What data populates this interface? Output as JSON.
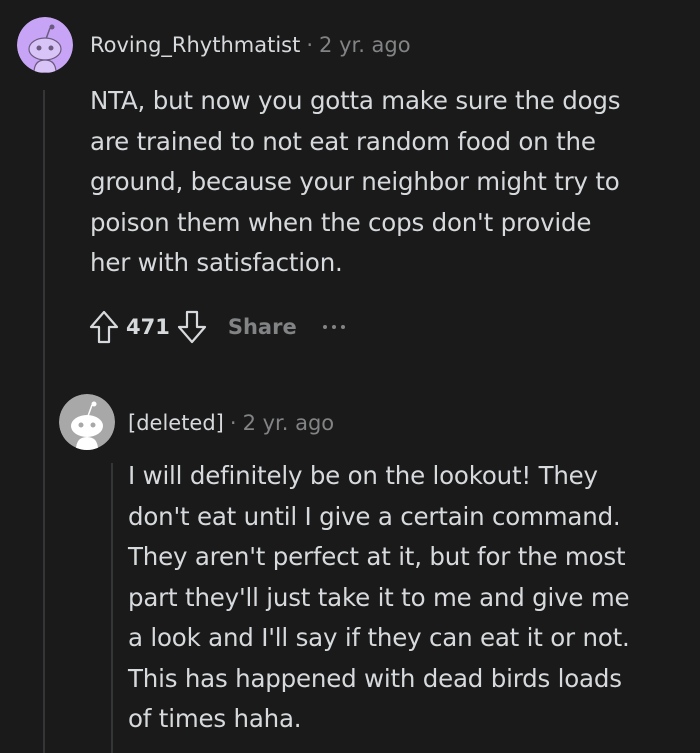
{
  "comment": {
    "author": "Roving_Rhythmatist",
    "separator": "·",
    "age": "2 yr. ago",
    "body_lines": [
      "NTA, but now you gotta make sure the dogs",
      "are trained to not eat random food on the",
      "ground, because your neighbor might try to",
      "poison them when the cops don't provide",
      "her with satisfaction."
    ],
    "score": "471",
    "share_label": "Share",
    "avatar_color": "#c7a4f5",
    "icons": [
      "upvote-icon",
      "downvote-icon",
      "more-options-icon"
    ]
  },
  "reply": {
    "author": "[deleted]",
    "separator": "·",
    "age": "2 yr. ago",
    "body_lines": [
      "I will definitely be on the lookout! They",
      "don't eat until I give a certain command.",
      "They aren't perfect at it, but for the most",
      "part they'll just take it to me and give me",
      "a look and I'll say if they can eat it or not.",
      "This has happened with dead birds loads",
      "of times haha."
    ],
    "avatar_color": "#a8a8a8"
  },
  "colors": {
    "background": "#1a1a1b",
    "text": "#d7dadc",
    "muted": "#818384",
    "thread_line": "#343536"
  }
}
